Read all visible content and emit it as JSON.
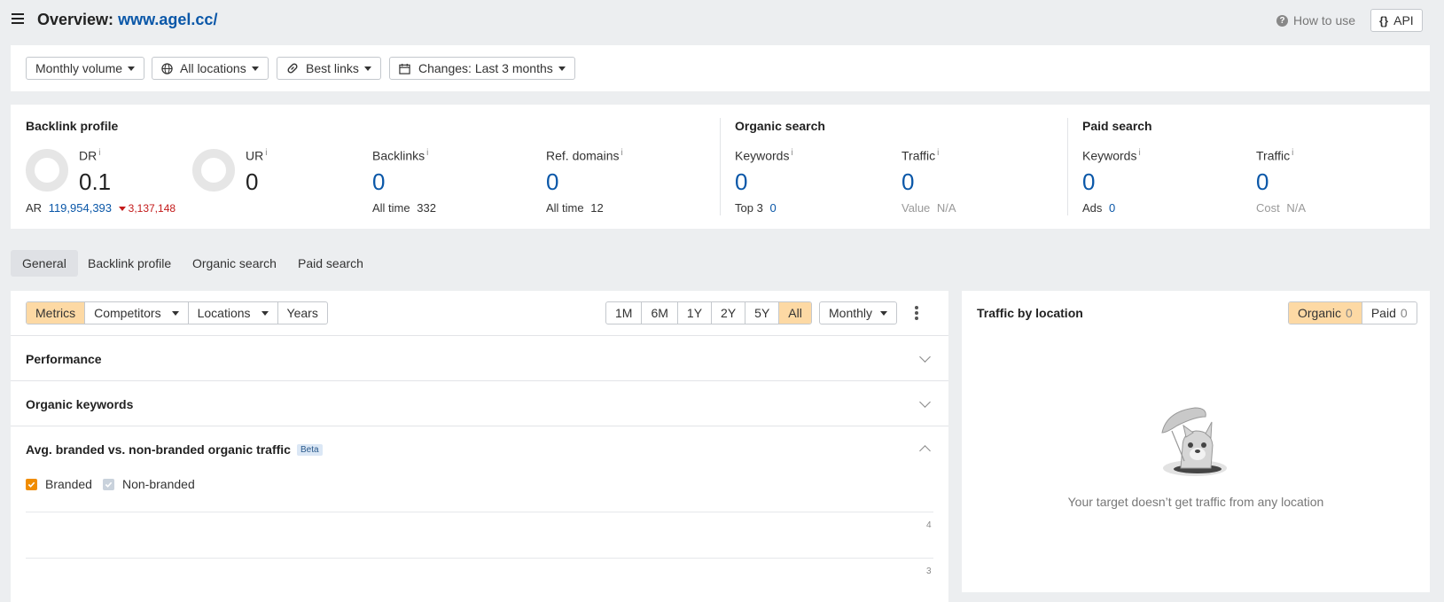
{
  "header": {
    "title_prefix": "Overview:",
    "title_domain": "www.agel.cc/",
    "how_to_use": "How to use",
    "api": "API"
  },
  "filters": {
    "volume": "Monthly volume",
    "locations": "All locations",
    "links": "Best links",
    "changes": "Changes: Last 3 months"
  },
  "backlink_profile": {
    "heading": "Backlink profile",
    "dr_label": "DR",
    "dr_value": "0.1",
    "ar_label": "AR",
    "ar_value": "119,954,393",
    "ar_change": "3,137,148",
    "ur_label": "UR",
    "ur_value": "0",
    "backlinks_label": "Backlinks",
    "backlinks_value": "0",
    "backlinks_alltime_label": "All time",
    "backlinks_alltime_value": "332",
    "refdomains_label": "Ref. domains",
    "refdomains_value": "0",
    "refdomains_alltime_label": "All time",
    "refdomains_alltime_value": "12"
  },
  "organic_search": {
    "heading": "Organic search",
    "keywords_label": "Keywords",
    "keywords_value": "0",
    "top3_label": "Top 3",
    "top3_value": "0",
    "traffic_label": "Traffic",
    "traffic_value": "0",
    "value_label": "Value",
    "value_value": "N/A"
  },
  "paid_search": {
    "heading": "Paid search",
    "keywords_label": "Keywords",
    "keywords_value": "0",
    "ads_label": "Ads",
    "ads_value": "0",
    "traffic_label": "Traffic",
    "traffic_value": "0",
    "cost_label": "Cost",
    "cost_value": "N/A"
  },
  "tabs": [
    "General",
    "Backlink profile",
    "Organic search",
    "Paid search"
  ],
  "left_panel": {
    "views": [
      "Metrics",
      "Competitors",
      "Locations",
      "Years"
    ],
    "ranges": [
      "1M",
      "6M",
      "1Y",
      "2Y",
      "5Y",
      "All"
    ],
    "interval": "Monthly",
    "sections": {
      "performance": "Performance",
      "organic_keywords": "Organic keywords",
      "branded": "Avg. branded vs. non-branded organic traffic",
      "beta": "Beta"
    },
    "legend": {
      "branded": "Branded",
      "nonbranded": "Non-branded"
    },
    "y_ticks": [
      "4",
      "3"
    ]
  },
  "right_panel": {
    "title": "Traffic by location",
    "organic_label": "Organic",
    "organic_count": "0",
    "paid_label": "Paid",
    "paid_count": "0",
    "empty_message": "Your target doesn’t get traffic from any location"
  },
  "colors": {
    "accent_blue": "#0a57a8",
    "active_orange": "#fdd9a4",
    "checkbox_orange": "#f08c00",
    "decline_red": "#c31a1a"
  },
  "icons": [
    "menu-icon",
    "question-icon",
    "braces-icon",
    "globe-icon",
    "link-icon",
    "calendar-icon",
    "kebab-icon",
    "chevron-down-icon",
    "chevron-up-icon",
    "mascot-illustration"
  ]
}
